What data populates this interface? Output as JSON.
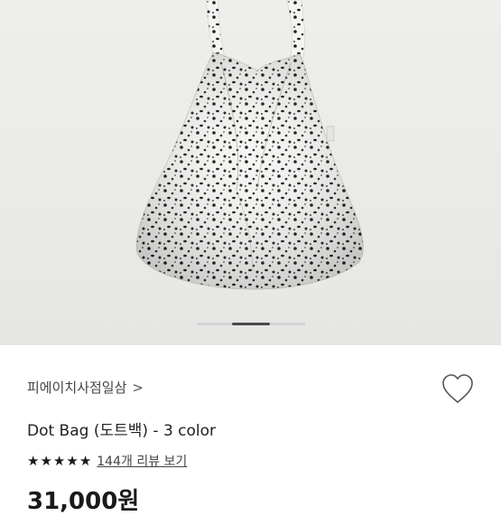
{
  "product": {
    "seller_name": "피에이치사점일삼",
    "seller_chevron": ">",
    "title": "Dot Bag (도트백) - 3 color",
    "rating_stars": 5,
    "review_link_text": "144개 리뷰 보기",
    "price": "31,000원"
  },
  "carousel": {
    "image_subject": "white dot-pattern hobo bag",
    "active_index_fraction": 0.4
  },
  "colors": {
    "star": "#1b1b1b",
    "background": "#ffffff",
    "hero_bg": "#eaeae8"
  },
  "icons": {
    "like": "heart-outline-icon",
    "chevron": "chevron-right-icon"
  }
}
